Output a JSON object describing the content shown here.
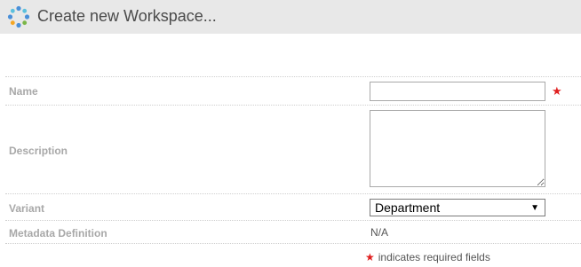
{
  "header": {
    "title": "Create new Workspace...",
    "logo_icon": "spinner-dots-logo",
    "logo_colors": [
      "#4a90d9",
      "#f5a623",
      "#7ab648",
      "#5bc0de"
    ]
  },
  "form": {
    "name": {
      "label": "Name",
      "value": "",
      "required": true
    },
    "description": {
      "label": "Description",
      "value": ""
    },
    "variant": {
      "label": "Variant",
      "selected": "Department"
    },
    "metadata_definition": {
      "label": "Metadata Definition",
      "value": "N/A"
    }
  },
  "footnote": {
    "star": "★",
    "text": "indicates required fields"
  },
  "required_star": "★",
  "colors": {
    "header_bg": "#e8e8e8",
    "label": "#a8a8a8",
    "required": "#e02020"
  }
}
